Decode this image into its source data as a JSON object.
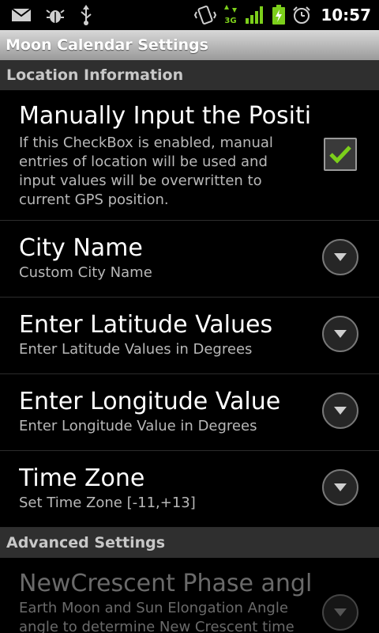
{
  "status_bar": {
    "time": "10:57",
    "network": "3G",
    "icons": [
      "mail-icon",
      "debug-icon",
      "usb-icon",
      "vibrate-icon",
      "network-3g-icon",
      "signal-icon",
      "battery-charging-icon",
      "alarm-icon"
    ]
  },
  "app": {
    "title": "Moon Calendar Settings"
  },
  "categories": {
    "location": "Location Information",
    "advanced": "Advanced Settings"
  },
  "prefs": {
    "manual_position": {
      "title": "Manually Input the Position",
      "summary": "If this CheckBox is enabled, manual entries of location will be used and input values will be overwritten to current GPS position.",
      "checked": true
    },
    "city_name": {
      "title": "City Name",
      "summary": "Custom City Name"
    },
    "latitude": {
      "title": "Enter Latitude Values",
      "summary": "Enter Latitude Values in Degrees"
    },
    "longitude": {
      "title": "Enter Longitude Value",
      "summary": "Enter Longitude Value in Degrees"
    },
    "time_zone": {
      "title": "Time Zone",
      "summary": "Set Time Zone [-11,+13]"
    },
    "new_crescent": {
      "title": "NewCrescent Phase angle",
      "summary": "Earth Moon and Sun Elongation Angle angle to determine New Crescent time"
    }
  },
  "colors": {
    "check": "#7ccf1b",
    "title_bar": "#b5b5b5",
    "category_bg": "#2f2f2f"
  }
}
